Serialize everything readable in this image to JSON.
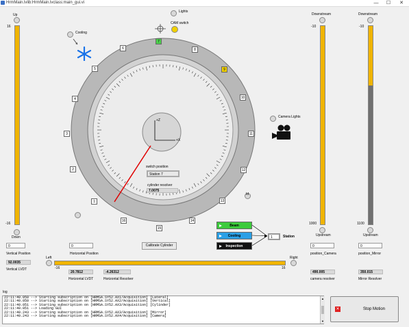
{
  "window": {
    "title": "HrmMain.lvlib:HrmMain.lvclass:main_gui.vi",
    "minimize": "—",
    "maximize": "☐",
    "close": "✕"
  },
  "left_panel": {
    "up_label": "Up",
    "down_label": "Down",
    "top_scale": "16",
    "bottom_scale": "-16",
    "vertical_position_value": "0",
    "vertical_position_label": "Vertical Position",
    "lvdt_value": "92.0035",
    "lvdt_label": "Vertical LVDT",
    "fill_fraction": 1.0
  },
  "center": {
    "cooling_label": "Cooling",
    "lights_label": "Lights",
    "cam_switch_label": "CAM switch",
    "camera_lights_label": "Camera Lights",
    "axis_z": "+Z",
    "axis_x": "+X",
    "switch_position_label": "switch position",
    "switch_position_value": "Station 7",
    "cylinder_resolver_label": "cylinder resolver",
    "cylinder_resolver_value": "7.0075",
    "id_label": "Id",
    "stations": [
      "1",
      "2",
      "3",
      "4",
      "5",
      "6",
      "7",
      "8",
      "9",
      "10",
      "11",
      "12",
      "13",
      "14",
      "15",
      "16"
    ],
    "calibrate_button": "Calibrate Cylinder",
    "horizontal_position_value": "0",
    "horizontal_position_label": "Horizontal Position",
    "left_label": "Left",
    "right_label": "Right",
    "h_min": "-16",
    "h_max": "16",
    "h_lvdt_value": "20.7812",
    "h_lvdt_label": "Horizontal LVDT",
    "h_resolver_value": "-4.26312",
    "h_resolver_label": "Horizontal Resolver",
    "h_fill_fraction": 1.0
  },
  "controls": {
    "beam": "Beam",
    "cooling": "Cooling",
    "inspection": "Inspection",
    "station_value": "1",
    "station_label": "Station",
    "beam_color": "#3ccb3c",
    "cooling_color": "#2aa0e6",
    "inspection_color": "#111111"
  },
  "camera_panel": {
    "downstream": "Downstream",
    "upstream": "Upstream",
    "top_scale": "-10",
    "bottom_scale": "1000",
    "position_value": "0",
    "position_label": "position_Camera",
    "resolver_value": "490.005",
    "resolver_label": "camera resolver",
    "fill_fraction": 1.0
  },
  "mirror_panel": {
    "downstream": "Downstream",
    "upstream": "Upstream",
    "top_scale": "-10",
    "bottom_scale": "1100",
    "position_value": "0",
    "position_label": "position_Mirror",
    "resolver_value": "350.015",
    "resolver_label": "Mirror Resolver",
    "fill_fraction": 0.3
  },
  "log": {
    "label": "log",
    "lines": [
      "22:11:40.050 --> Starting subscription on [HRMSA.SY52.AX1/Acquisition] [Lateral]",
      "22:11:40.050 --> Starting subscription on [HRMSA.SY52.AX2/Acquisition] [Vertical]",
      "22:11:40.051 --> Starting subscription on [HRMSA.SY52.AX3/Acquisition] [Cylinder]",
      "22:11:40.051 --> Loading GUI",
      "22:11:40.243 --> Starting subscription on [HRMSA.SY52.AX3/Acquisition] [Mirror]",
      "22:11:40.243 --> Starting subscription on [HRMSA.SY52.AX4/Acquisition] [Camera]"
    ]
  },
  "stop_button": {
    "label": "Stop Motion",
    "icon": "stop-icon"
  }
}
